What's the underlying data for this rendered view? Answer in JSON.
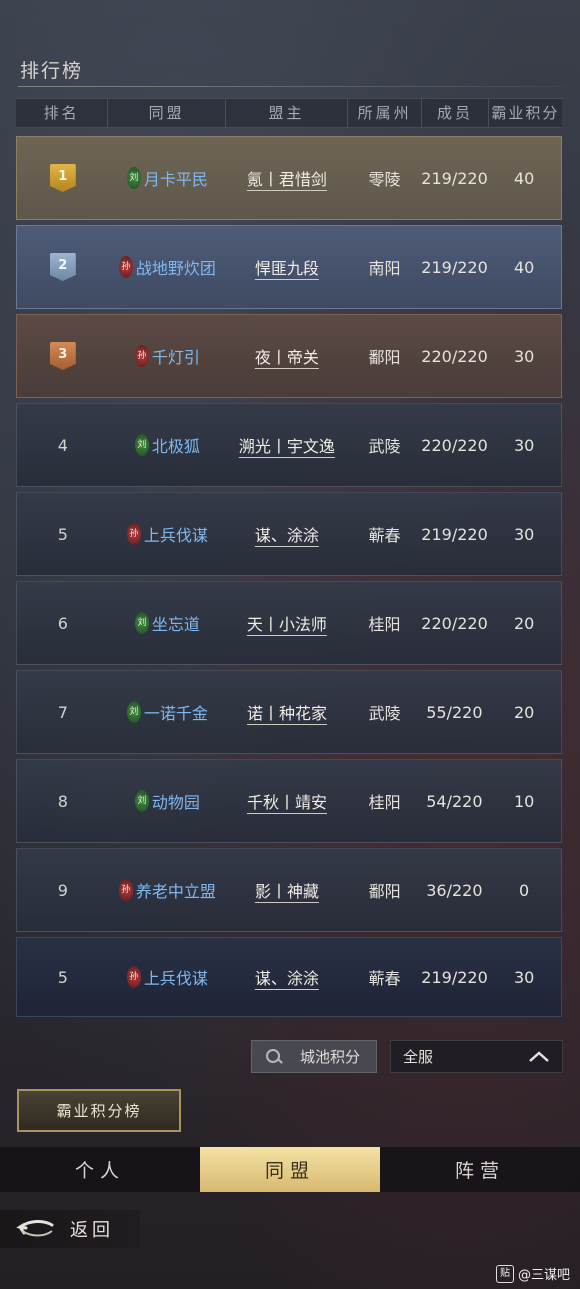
{
  "page_title": "排行榜",
  "columns": [
    "排名",
    "同盟",
    "盟主",
    "所属州",
    "成员",
    "霸业积分"
  ],
  "rows": [
    {
      "rank": "1",
      "faction": "刘",
      "alliance": "月卡平民",
      "leader": "氪丨君惜剑",
      "state": "零陵",
      "members": "219/220",
      "score": "40"
    },
    {
      "rank": "2",
      "faction": "孙",
      "alliance": "战地野炊团",
      "leader": "悍匪九段",
      "state": "南阳",
      "members": "219/220",
      "score": "40"
    },
    {
      "rank": "3",
      "faction": "孙",
      "alliance": "千灯引",
      "leader": "夜丨帝关",
      "state": "鄱阳",
      "members": "220/220",
      "score": "30"
    },
    {
      "rank": "4",
      "faction": "刘",
      "alliance": "北极狐",
      "leader": "溯光丨宇文逸",
      "state": "武陵",
      "members": "220/220",
      "score": "30"
    },
    {
      "rank": "5",
      "faction": "孙",
      "alliance": "上兵伐谋",
      "leader": "谋、涂涂",
      "state": "蕲春",
      "members": "219/220",
      "score": "30"
    },
    {
      "rank": "6",
      "faction": "刘",
      "alliance": "坐忘道",
      "leader": "天丨小法师",
      "state": "桂阳",
      "members": "220/220",
      "score": "20"
    },
    {
      "rank": "7",
      "faction": "刘",
      "alliance": "一诺千金",
      "leader": "诺丨种花家",
      "state": "武陵",
      "members": "55/220",
      "score": "20"
    },
    {
      "rank": "8",
      "faction": "刘",
      "alliance": "动物园",
      "leader": "千秋丨靖安",
      "state": "桂阳",
      "members": "54/220",
      "score": "10"
    },
    {
      "rank": "9",
      "faction": "孙",
      "alliance": "养老中立盟",
      "leader": "影丨神藏",
      "state": "鄱阳",
      "members": "36/220",
      "score": "0"
    },
    {
      "rank": "5",
      "faction": "孙",
      "alliance": "上兵伐谋",
      "leader": "谋、涂涂",
      "state": "蕲春",
      "members": "219/220",
      "score": "30"
    }
  ],
  "filter": {
    "search_label": "城池积分",
    "server_label": "全服"
  },
  "ranking_tab_label": "霸业积分榜",
  "bottom_tabs": [
    "个人",
    "同盟",
    "阵营"
  ],
  "active_bottom_tab": "同盟",
  "back_label": "返回",
  "watermark": "@三谋吧",
  "colors": {
    "alliance_text": "#7fb8f0",
    "gold": "#e3b648",
    "silver": "#9cb4d0",
    "bronze": "#d58a55",
    "active_tab": "#f4e2a4"
  }
}
